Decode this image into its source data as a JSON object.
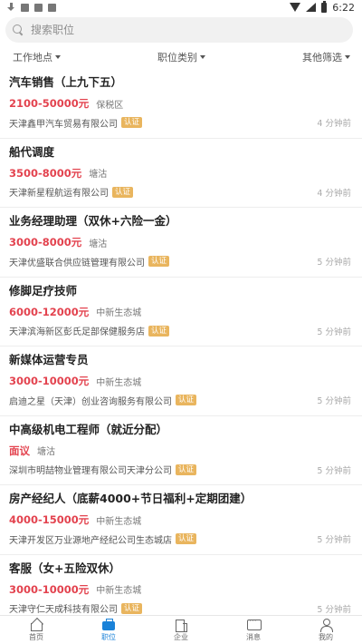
{
  "status_bar": {
    "time": "6:22"
  },
  "search": {
    "placeholder": "搜索职位",
    "value": ""
  },
  "filters": {
    "location": "工作地点",
    "category": "职位类别",
    "other": "其他筛选"
  },
  "jobs": [
    {
      "title": "汽车销售（上九下五）",
      "salary": "2100-50000元",
      "area": "保税区",
      "company": "天津鑫甲汽车贸易有限公司",
      "badge": "认证",
      "time": "4 分钟前"
    },
    {
      "title": "船代调度",
      "salary": "3500-8000元",
      "area": "塘沽",
      "company": "天津新星程航运有限公司",
      "badge": "认证",
      "time": "4 分钟前"
    },
    {
      "title": "业务经理助理（双休+六险一金）",
      "salary": "3000-8000元",
      "area": "塘沽",
      "company": "天津优盛联合供应链管理有限公司",
      "badge": "认证",
      "time": "5 分钟前"
    },
    {
      "title": "修脚足疗技师",
      "salary": "6000-12000元",
      "area": "中新生态城",
      "company": "天津滨海新区彭氏足部保健服务店",
      "badge": "认证",
      "time": "5 分钟前"
    },
    {
      "title": "新媒体运营专员",
      "salary": "3000-10000元",
      "area": "中新生态城",
      "company": "启迪之星（天津）创业咨询服务有限公司",
      "badge": "认证",
      "time": "5 分钟前"
    },
    {
      "title": "中高级机电工程师（就近分配）",
      "salary": "面议",
      "area": "塘沽",
      "company": "深圳市明喆物业管理有限公司天津分公司",
      "badge": "认证",
      "time": "5 分钟前"
    },
    {
      "title": "房产经纪人（底薪4000+节日福利+定期团建）",
      "salary": "4000-15000元",
      "area": "中新生态城",
      "company": "天津开发区万业源地产经纪公司生态城店",
      "badge": "认证",
      "time": "5 分钟前"
    },
    {
      "title": "客服（女+五险双休）",
      "salary": "3000-10000元",
      "area": "中新生态城",
      "company": "天津守仁天成科技有限公司",
      "badge": "认证",
      "time": "5 分钟前"
    }
  ],
  "tabbar": {
    "items": [
      {
        "label": "首页",
        "icon": "home-icon"
      },
      {
        "label": "职位",
        "icon": "briefcase-icon"
      },
      {
        "label": "企业",
        "icon": "building-icon"
      },
      {
        "label": "消息",
        "icon": "message-icon"
      },
      {
        "label": "我的",
        "icon": "user-icon"
      }
    ],
    "active_color": "#1a82d8"
  },
  "colors": {
    "salary": "#e3434f",
    "badge": "#e9b55e",
    "accent": "#1a82d8"
  }
}
